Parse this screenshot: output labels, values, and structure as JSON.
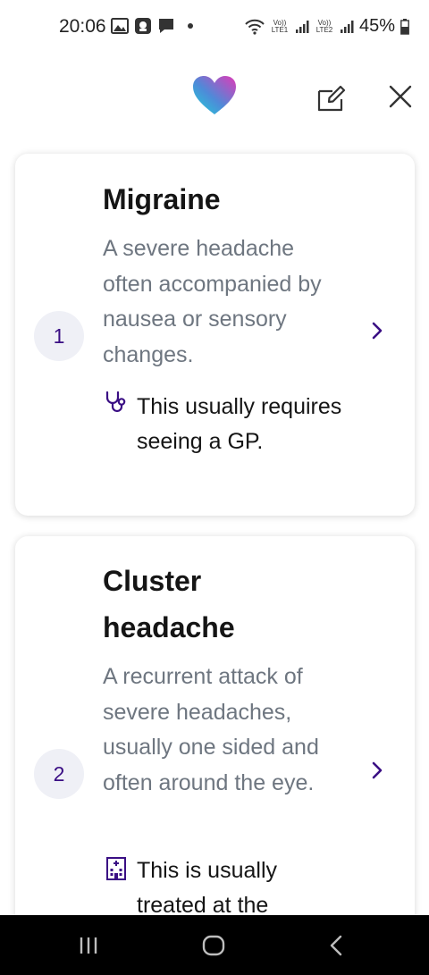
{
  "status_bar": {
    "time": "20:06",
    "battery": "45%",
    "sim1": "Vo)) LTE1",
    "sim2": "Vo)) LTE2"
  },
  "header": {
    "logo": "heart-logo",
    "edit_icon": "edit-icon",
    "close_icon": "close-icon",
    "colors": {
      "logo_start": "#1fd1d8",
      "logo_end": "#d43bc6",
      "icon": "#333333"
    }
  },
  "conditions": [
    {
      "rank": "1",
      "title": "Migraine",
      "description": "A severe headache often accompanied by nausea or sensory changes.",
      "care_icon": "stethoscope-icon",
      "care_note": "This usually requires seeing a GP."
    },
    {
      "rank": "2",
      "title": "Cluster headache",
      "description": "A recurrent attack of severe headaches, usually one sided and often around the eye.",
      "care_icon": "hospital-icon",
      "care_note": "This is usually treated at the"
    }
  ],
  "colors": {
    "accent": "#3a0e84",
    "badge_bg": "#eff0f6",
    "description_text": "#6e7680"
  },
  "nav_bar": {
    "recents_icon": "recents-icon",
    "home_icon": "home-icon",
    "back_icon": "back-icon"
  }
}
